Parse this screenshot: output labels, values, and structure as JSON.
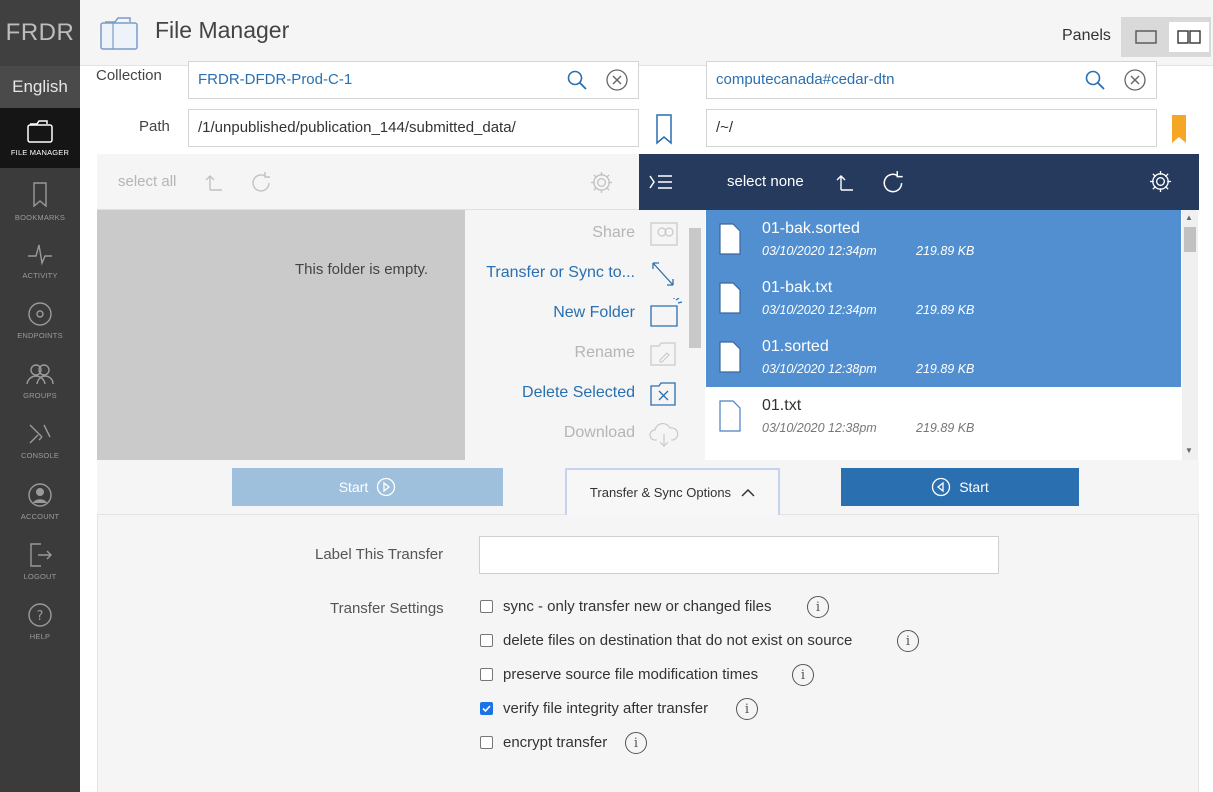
{
  "brand": "FRDR",
  "language": "English",
  "nav": [
    {
      "label": "FILE MANAGER",
      "icon": "folder-icon"
    },
    {
      "label": "BOOKMARKS",
      "icon": "bookmark-icon"
    },
    {
      "label": "ACTIVITY",
      "icon": "activity-icon"
    },
    {
      "label": "ENDPOINTS",
      "icon": "endpoint-icon"
    },
    {
      "label": "GROUPS",
      "icon": "groups-icon"
    },
    {
      "label": "CONSOLE",
      "icon": "console-icon"
    },
    {
      "label": "ACCOUNT",
      "icon": "account-icon"
    },
    {
      "label": "LOGOUT",
      "icon": "logout-icon"
    },
    {
      "label": "HELP",
      "icon": "help-icon"
    }
  ],
  "header": {
    "title": "File Manager",
    "panels_label": "Panels"
  },
  "labels": {
    "collection": "Collection",
    "path": "Path"
  },
  "left": {
    "collection": "FRDR-DFDR-Prod-C-1",
    "path": "/1/unpublished/publication_144/submitted_data/",
    "select_label": "select all",
    "empty_message": "This folder is empty."
  },
  "right": {
    "collection": "computecanada#cedar-dtn",
    "path": "/~/",
    "select_label": "select none",
    "files": [
      {
        "name": "01-bak.sorted",
        "date": "03/10/2020 12:34pm",
        "size": "219.89 KB",
        "selected": true
      },
      {
        "name": "01-bak.txt",
        "date": "03/10/2020 12:34pm",
        "size": "219.89 KB",
        "selected": true
      },
      {
        "name": "01.sorted",
        "date": "03/10/2020 12:38pm",
        "size": "219.89 KB",
        "selected": true
      },
      {
        "name": "01.txt",
        "date": "03/10/2020 12:38pm",
        "size": "219.89 KB",
        "selected": false
      }
    ]
  },
  "actions": [
    {
      "label": "Share",
      "enabled": false,
      "icon": "share-icon"
    },
    {
      "label": "Transfer or Sync to...",
      "enabled": true,
      "icon": "transfer-icon"
    },
    {
      "label": "New Folder",
      "enabled": true,
      "icon": "new-folder-icon"
    },
    {
      "label": "Rename",
      "enabled": false,
      "icon": "rename-icon"
    },
    {
      "label": "Delete Selected",
      "enabled": true,
      "icon": "delete-icon"
    },
    {
      "label": "Download",
      "enabled": false,
      "icon": "download-icon"
    }
  ],
  "start_left": "Start",
  "start_right": "Start",
  "options_toggle": "Transfer & Sync Options",
  "options": {
    "label_field": "Label This Transfer",
    "label_value": "",
    "settings_label": "Transfer Settings",
    "settings": [
      {
        "label": "sync - only transfer new or changed files",
        "checked": false
      },
      {
        "label": "delete files on destination that do not exist on source",
        "checked": false
      },
      {
        "label": "preserve source file modification times",
        "checked": false
      },
      {
        "label": "verify file integrity after transfer",
        "checked": true
      },
      {
        "label": "encrypt transfer",
        "checked": false
      }
    ]
  },
  "colors": {
    "accent": "#2a6fb0",
    "selected_row": "#518fd1",
    "dark_toolbar": "#263a5e",
    "bookmark_active": "#f5a623"
  }
}
